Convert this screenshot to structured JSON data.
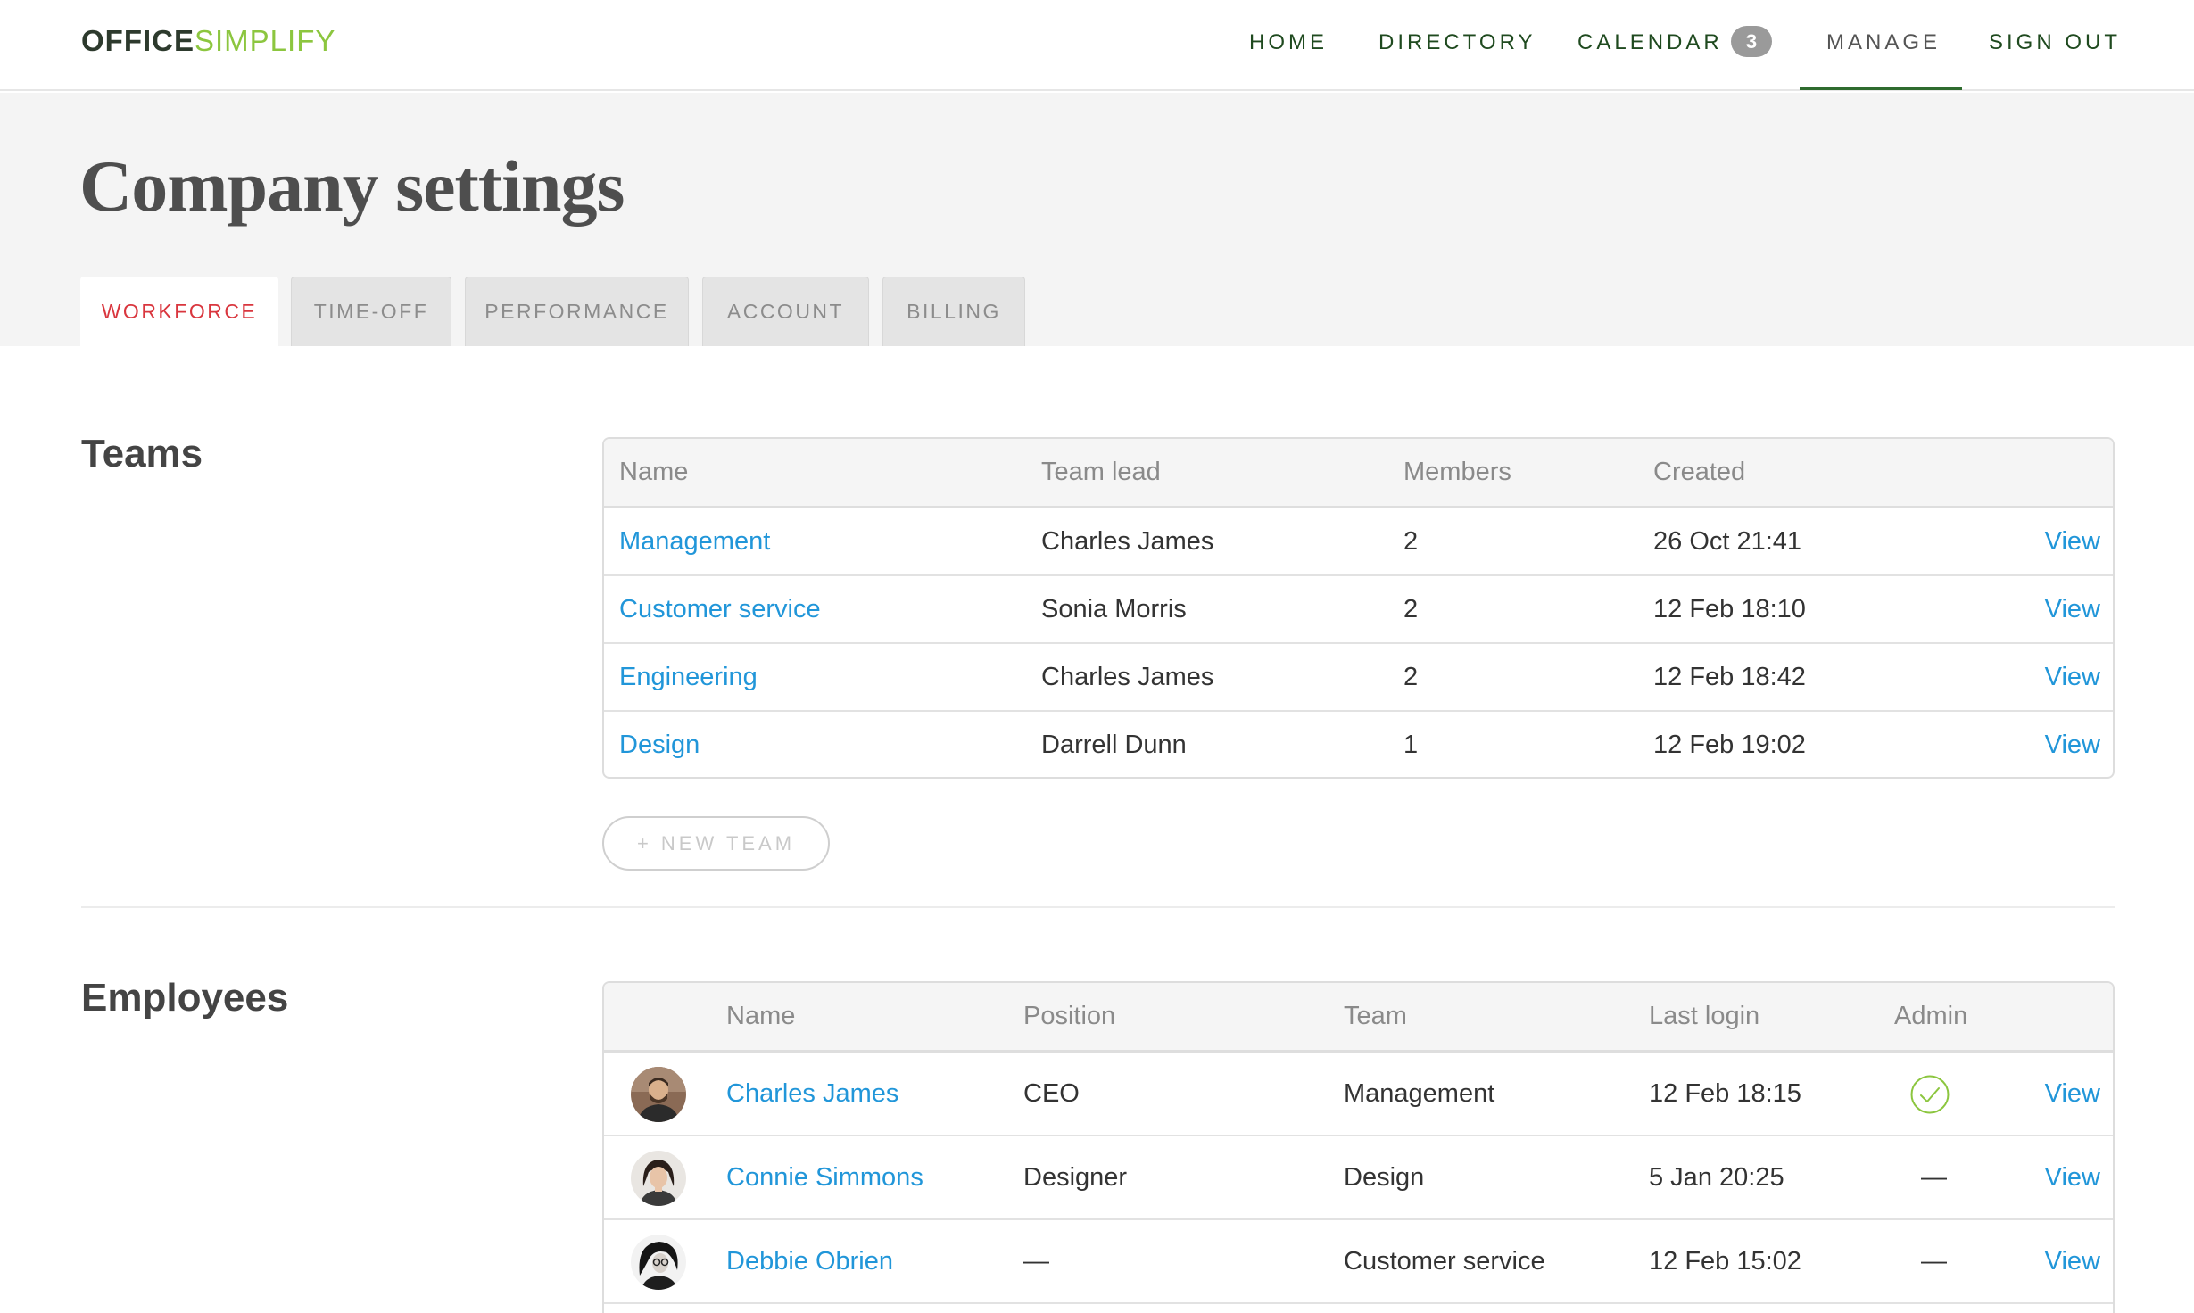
{
  "brand": {
    "part1": "OFFICE",
    "part2": "SIMPLIFY"
  },
  "nav": {
    "home": "HOME",
    "directory": "DIRECTORY",
    "calendar": "CALENDAR",
    "calendar_badge": "3",
    "manage": "MANAGE",
    "signout": "SIGN OUT"
  },
  "page": {
    "title": "Company settings"
  },
  "tabs": [
    "WORKFORCE",
    "TIME-OFF",
    "PERFORMANCE",
    "ACCOUNT",
    "BILLING"
  ],
  "teams": {
    "title": "Teams",
    "headers": {
      "name": "Name",
      "lead": "Team lead",
      "members": "Members",
      "created": "Created"
    },
    "rows": [
      {
        "name": "Management",
        "lead": "Charles James",
        "members": "2",
        "created": "26 Oct 21:41",
        "action": "View"
      },
      {
        "name": "Customer service",
        "lead": "Sonia Morris",
        "members": "2",
        "created": "12 Feb 18:10",
        "action": "View"
      },
      {
        "name": "Engineering",
        "lead": "Charles James",
        "members": "2",
        "created": "12 Feb 18:42",
        "action": "View"
      },
      {
        "name": "Design",
        "lead": "Darrell Dunn",
        "members": "1",
        "created": "12 Feb 19:02",
        "action": "View"
      }
    ],
    "new_team_label": "+ NEW TEAM"
  },
  "employees": {
    "title": "Employees",
    "headers": {
      "name": "Name",
      "position": "Position",
      "team": "Team",
      "last_login": "Last login",
      "admin": "Admin"
    },
    "rows": [
      {
        "name": "Charles James",
        "position": "CEO",
        "team": "Management",
        "last_login": "12 Feb 18:15",
        "admin": "",
        "action": "View"
      },
      {
        "name": "Connie Simmons",
        "position": "Designer",
        "team": "Design",
        "last_login": "5 Jan 20:25",
        "admin": "—",
        "action": "View"
      },
      {
        "name": "Debbie Obrien",
        "position": "—",
        "team": "Customer service",
        "last_login": "12 Feb 15:02",
        "admin": "—",
        "action": "View"
      }
    ]
  },
  "colors": {
    "accent_green": "#8cc63f",
    "nav_green": "#1f4a1f",
    "link_blue": "#2196d9",
    "active_tab_red": "#d9363e"
  },
  "icons": {
    "admin_check": "check-circle-icon"
  }
}
